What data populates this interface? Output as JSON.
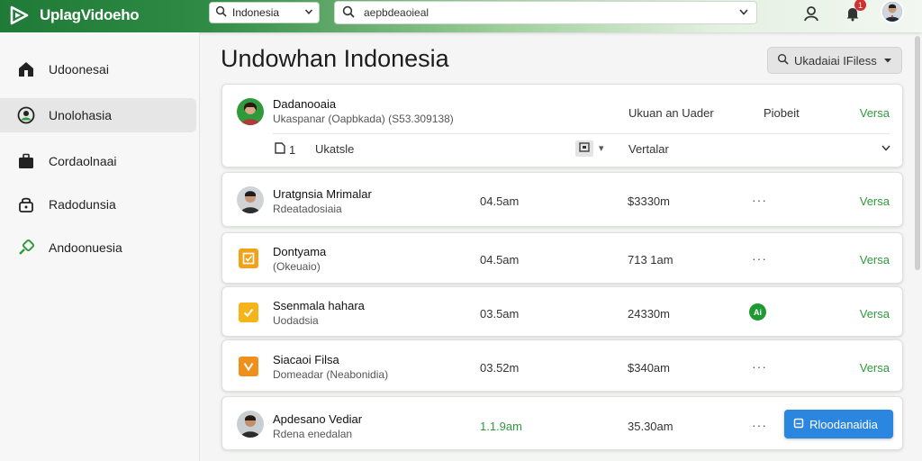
{
  "app": {
    "title": "UplagVidoeho",
    "language": "Indonesia",
    "search_value": "aepbdeaoieal",
    "notification_count": "1"
  },
  "sidebar": {
    "items": [
      {
        "label": "Udoonesai",
        "icon": "home-icon"
      },
      {
        "label": "Unolohasia",
        "icon": "user-circle-icon"
      },
      {
        "label": "Cordaolnaai",
        "icon": "briefcase-icon"
      },
      {
        "label": "Radodunsia",
        "icon": "lock-icon"
      },
      {
        "label": "Andoonuesia",
        "icon": "link-icon"
      }
    ],
    "active_index": 1
  },
  "main": {
    "title": "Undowhan Indonesia",
    "files_button": "Ukadaiai IFiless"
  },
  "top_card": {
    "name": "Dadanooaia",
    "sub": "Ukaspanar (Oapbkada) (S53.309138)",
    "col1": "Ukuan an Uader",
    "col2": "Piobeit",
    "col3": "Versa",
    "count": "1",
    "field_label": "Ukatsle",
    "select_value": "Vertalar"
  },
  "rows": [
    {
      "name": "Uratgnsia Mrimalar",
      "sub": "Rdeatadosiaia",
      "time": "04.5am",
      "amount": "$3330m",
      "action": "Versa"
    },
    {
      "name": "Dontyama",
      "sub": "(Okeuaio)",
      "time": "04.5am",
      "amount": "713 1am",
      "action": "Versa"
    },
    {
      "name": "Ssenmala hahara",
      "sub": "Uodadsia",
      "time": "03.5am",
      "amount": "24330m",
      "action": "Versa",
      "status_badge": "Ai"
    },
    {
      "name": "Siacaoi Filsa",
      "sub": "Domeadar (Neabonidia)",
      "time": "03.52m",
      "amount": "$340am",
      "action": "Versa"
    },
    {
      "name": "Apdesano Vediar",
      "sub": "Rdena enedalan",
      "time": "1.1.9am",
      "amount": "35.30am",
      "action_button": "Rloodanaidia"
    }
  ],
  "colors": {
    "brand_green": "#1f7a37",
    "accent_green": "#2e9a3c",
    "button_blue": "#2b86e0",
    "check_orange": "#f0a21a"
  }
}
